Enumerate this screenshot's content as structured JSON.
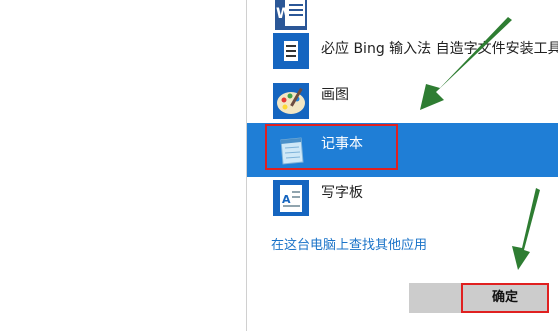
{
  "dialog": {
    "apps": [
      {
        "label": "",
        "icon": "word-icon"
      },
      {
        "label": "必应 Bing 输入法 自造字文件安装工具",
        "icon": "bing-ime-icon"
      },
      {
        "label": "画图",
        "icon": "paint-icon"
      },
      {
        "label": "记事本",
        "icon": "notepad-icon",
        "selected": true
      },
      {
        "label": "写字板",
        "icon": "wordpad-icon"
      }
    ],
    "more_apps_link": "在这台电脑上查找其他应用",
    "ok_button": "确定"
  },
  "colors": {
    "selection": "#1f7ed6",
    "link": "#1a73c8",
    "annotation_red": "#e02020",
    "annotation_green": "#2e7d32"
  }
}
